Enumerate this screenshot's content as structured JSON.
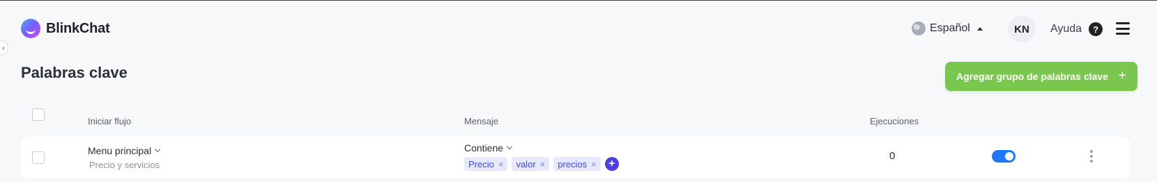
{
  "app": {
    "name": "BlinkChat"
  },
  "header": {
    "language": "Español",
    "avatar_initials": "KN",
    "help_label": "Ayuda",
    "help_icon_glyph": "?"
  },
  "page": {
    "title": "Palabras clave",
    "add_button_label": "Agregar grupo de palabras clave",
    "add_button_icon": "+"
  },
  "table": {
    "columns": {
      "start_flow": "Iniciar flujo",
      "message": "Mensaje",
      "executions": "Ejecuciones"
    },
    "rows": [
      {
        "flow_name": "Menu principal",
        "flow_subtitle": "Precio y servicios",
        "condition": "Contiene",
        "keywords": [
          "Precio",
          "valor",
          "precios"
        ],
        "executions": "0",
        "enabled": true
      }
    ]
  },
  "colors": {
    "accent_green": "#7ac74f",
    "toggle_blue": "#1e78ff",
    "tag_bg": "#e6e9ff",
    "tag_text": "#3b4bd8"
  },
  "icons": {
    "tag_remove": "×",
    "tag_add": "+"
  }
}
